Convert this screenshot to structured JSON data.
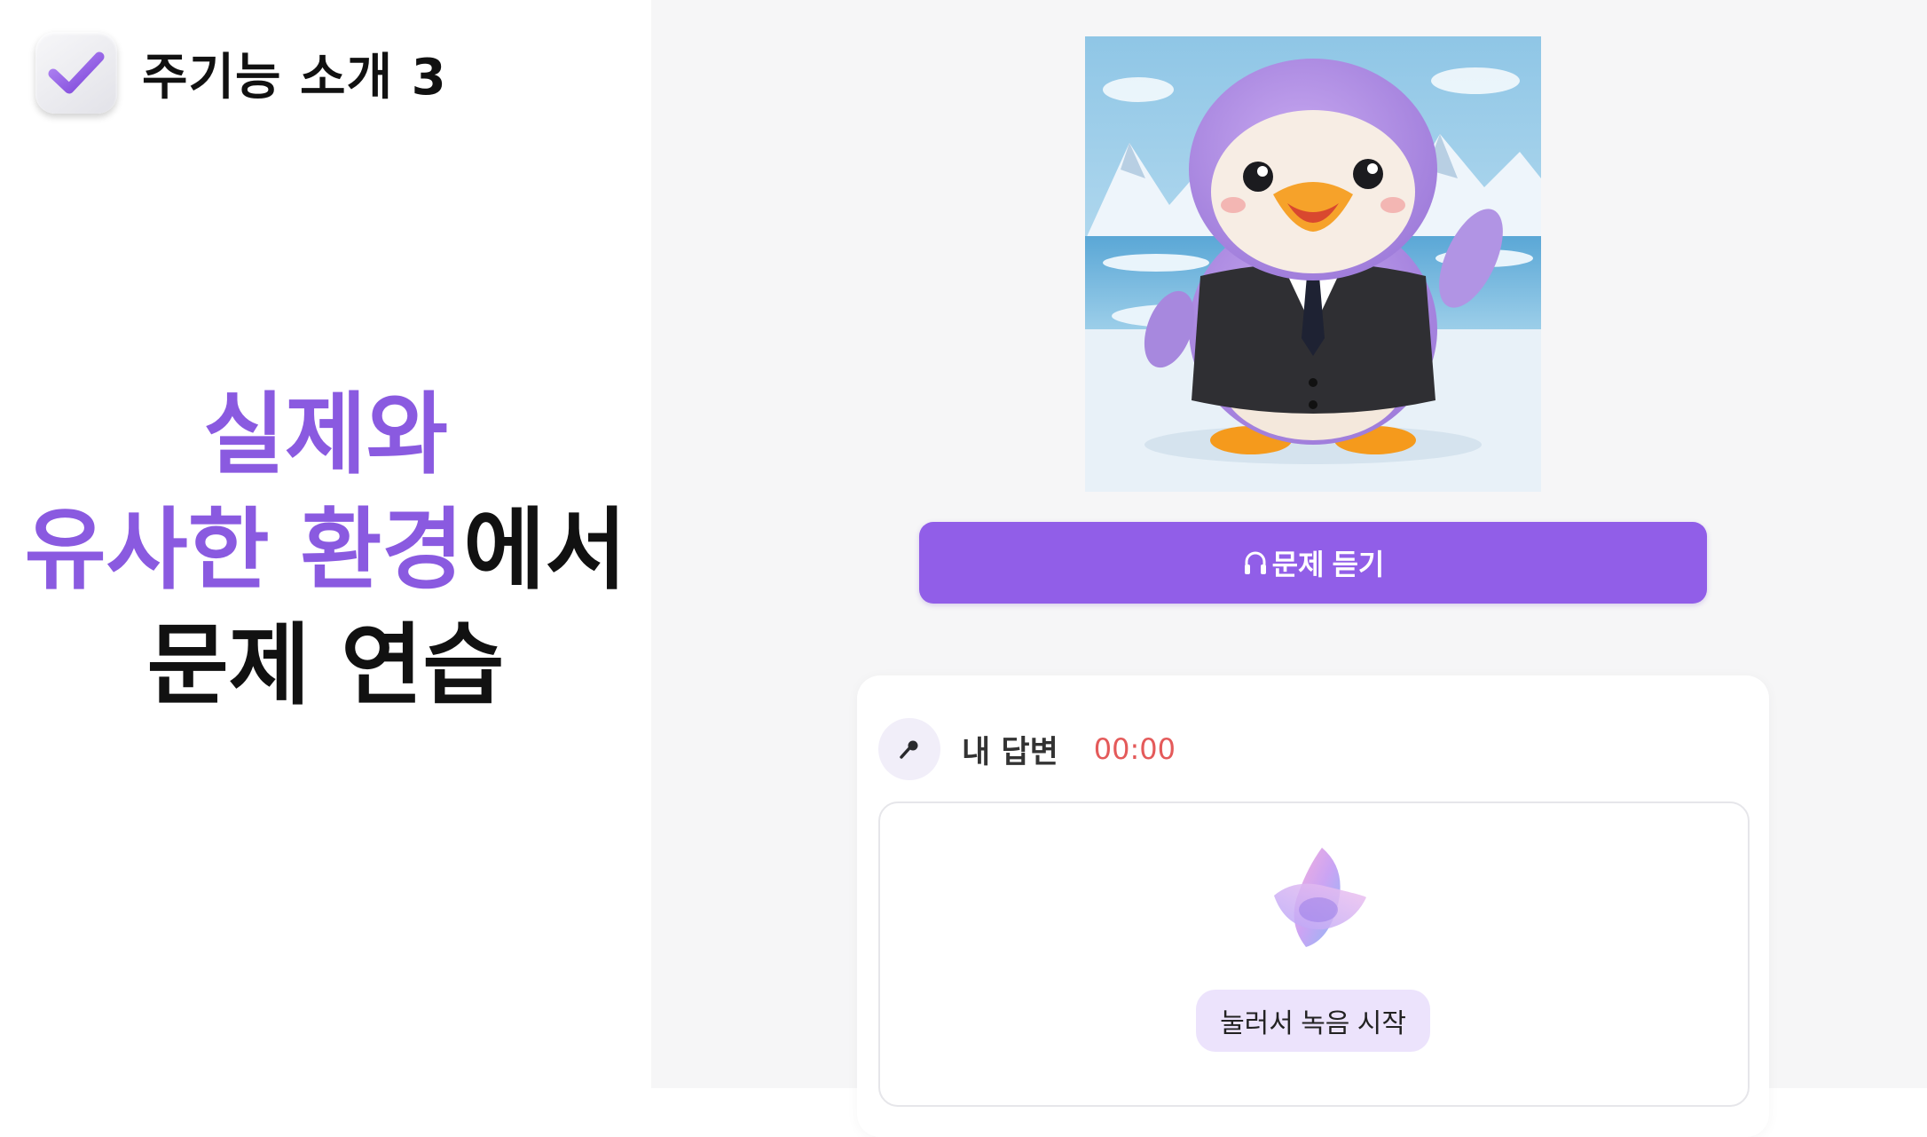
{
  "header": {
    "title": "주기능 소개 3",
    "icon": "checkbox-check-icon"
  },
  "headline": {
    "line1": "실제와",
    "line2_accent": "유사한 환경",
    "line2_rest": "에서",
    "line3": "문제 연습"
  },
  "colors": {
    "accent": "#8a5ae0",
    "button": "#915ee8",
    "timer": "#e45a5a",
    "record_pill": "#ece3fc"
  },
  "practice": {
    "listen_button": {
      "icon": "headphone-icon",
      "label": "문제 듣기"
    },
    "answer": {
      "icon": "microphone-icon",
      "title": "내 답변",
      "timer": "00:00",
      "record_label": "눌러서 녹음 시작"
    }
  }
}
